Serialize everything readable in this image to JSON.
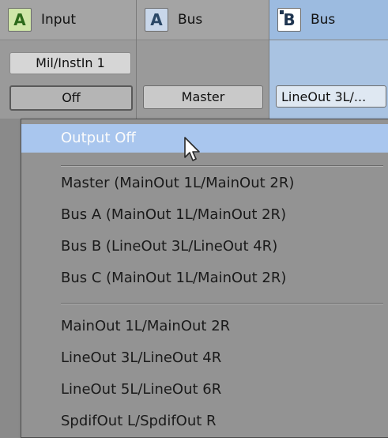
{
  "channels": [
    {
      "badge": "A",
      "label": "Input",
      "chip": "Mil/InstIn 1",
      "output": "Off"
    },
    {
      "badge": "A",
      "label": "Bus",
      "output": "Master"
    },
    {
      "badge": "B",
      "label": "Bus",
      "output": "LineOut 3L/..."
    }
  ],
  "menu": {
    "highlighted": "Output Off",
    "groups": [
      [
        "Master (MainOut 1L/MainOut 2R)",
        "Bus A (MainOut 1L/MainOut 2R)",
        "Bus B (LineOut 3L/LineOut 4R)",
        "Bus C (MainOut 1L/MainOut 2R)"
      ],
      [
        "MainOut 1L/MainOut 2R",
        "LineOut 3L/LineOut 4R",
        "LineOut 5L/LineOut 6R",
        "SpdifOut L/SpdifOut R"
      ]
    ]
  },
  "colors": {
    "highlight": "#a9c6ee",
    "bus_b_column": "#a9c3e2"
  }
}
